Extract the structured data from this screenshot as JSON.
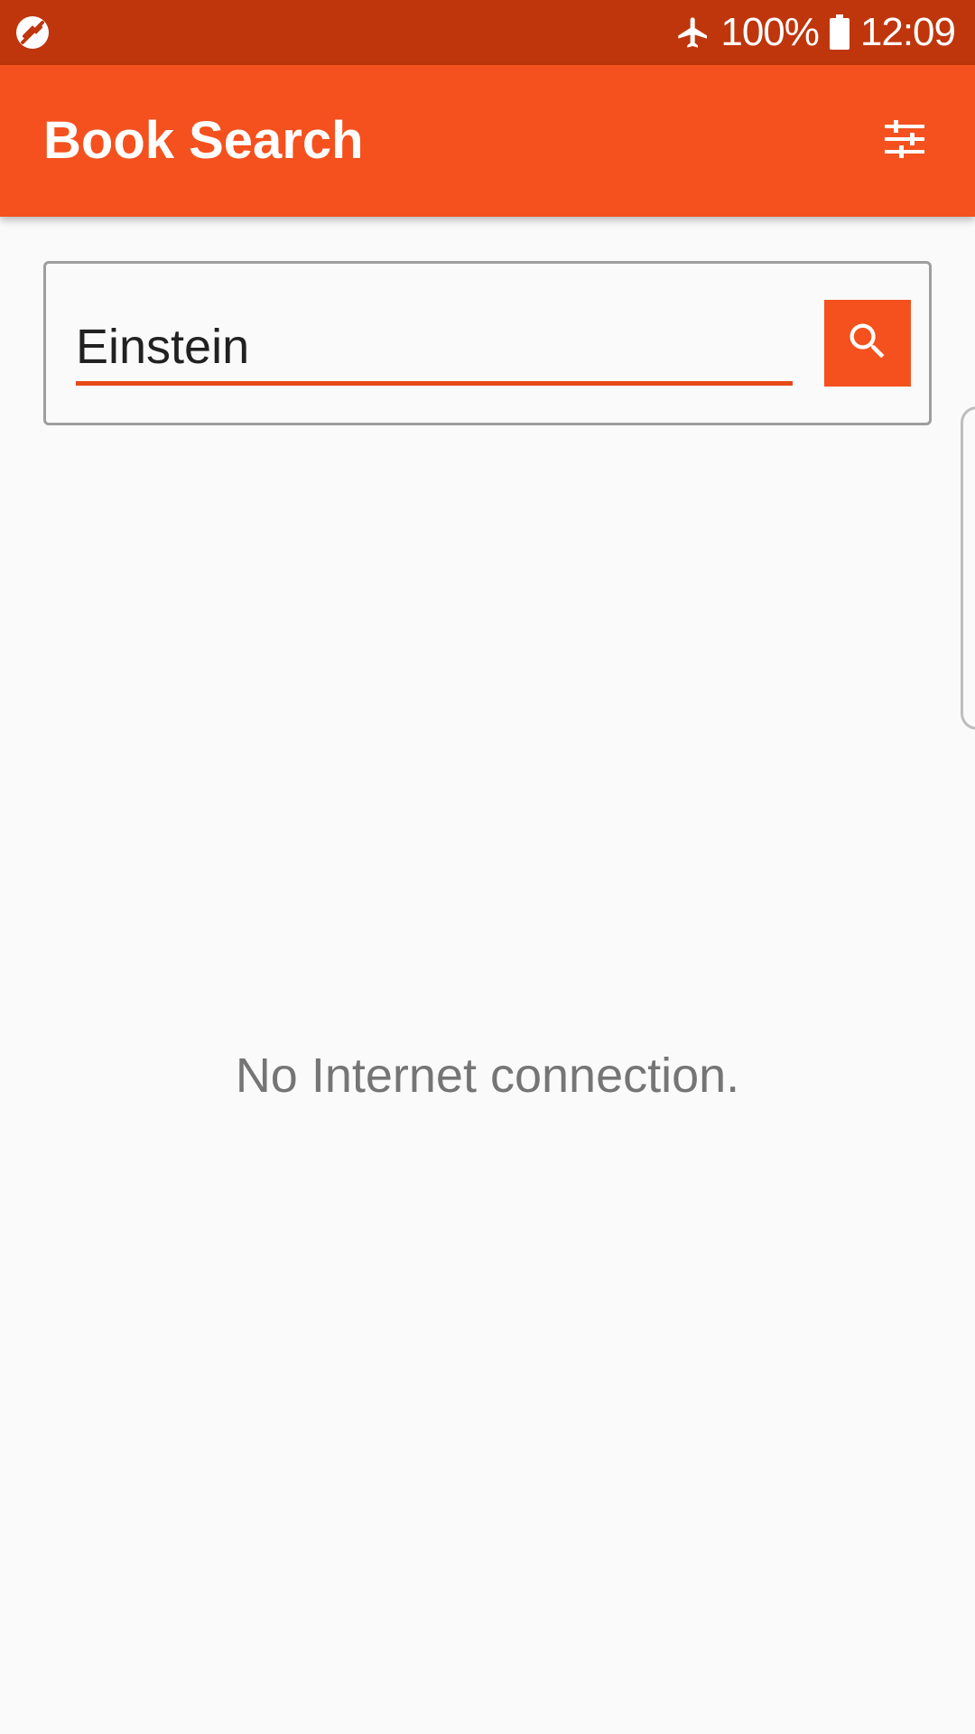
{
  "status_bar": {
    "left_icon": "no-sync-icon",
    "airplane_icon": "airplane-icon",
    "battery_percent": "100%",
    "battery_icon": "battery-full-icon",
    "time": "12:09"
  },
  "app_bar": {
    "title": "Book Search",
    "filter_icon": "tune-icon"
  },
  "search": {
    "value": "Einstein",
    "button_icon": "search-icon"
  },
  "empty_state": {
    "message": "No Internet connection."
  },
  "colors": {
    "status_bar": "#bf360c",
    "primary": "#f4511e",
    "accent_underline": "#e64a19",
    "background": "#fafafa",
    "message_text": "#757575"
  }
}
